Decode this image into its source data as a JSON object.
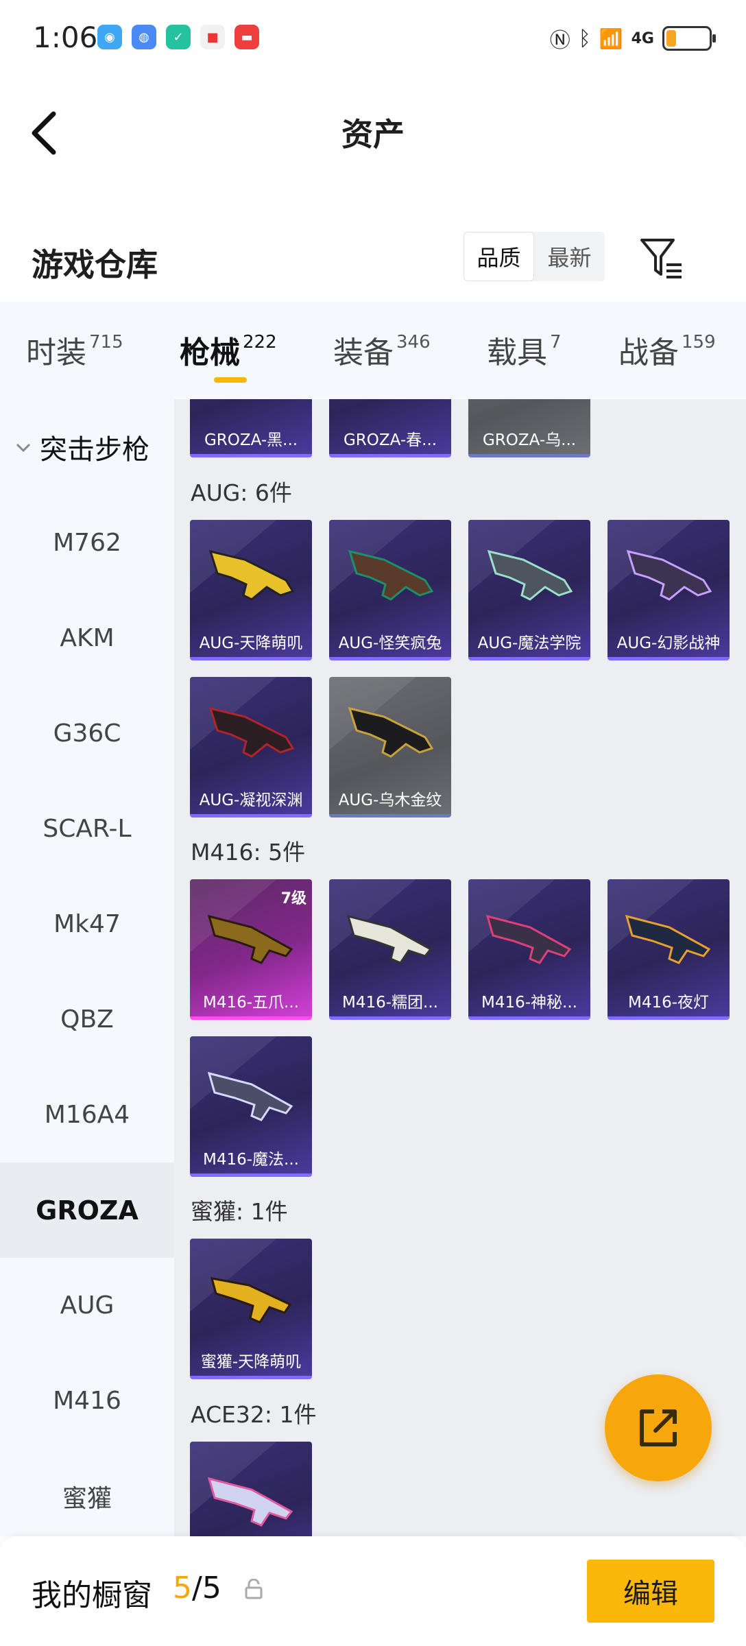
{
  "status_bar": {
    "time": "1:06",
    "signal_text": "4G",
    "wifi_badge": "6",
    "battery_color": "#f5a623"
  },
  "header": {
    "title": "资产",
    "back_icon": "chevron-left-icon"
  },
  "section": {
    "title": "游戏仓库",
    "sort_options": [
      "品质",
      "最新"
    ],
    "sort_selected": "品质",
    "filter_icon": "filter-icon"
  },
  "tabs": [
    {
      "label": "时装",
      "count": "715"
    },
    {
      "label": "枪械",
      "count": "222"
    },
    {
      "label": "装备",
      "count": "346"
    },
    {
      "label": "载具",
      "count": "7"
    },
    {
      "label": "战备",
      "count": "159"
    }
  ],
  "active_tab": "枪械",
  "sidebar": {
    "category": "突击步枪",
    "items": [
      "M762",
      "AKM",
      "G36C",
      "SCAR-L",
      "Mk47",
      "QBZ",
      "M16A4",
      "GROZA",
      "AUG",
      "M416",
      "蜜獾"
    ],
    "selected": "GROZA"
  },
  "groups": {
    "groza_partial": [
      "GROZA-黑...",
      "GROZA-春...",
      "GROZA-乌..."
    ],
    "aug": {
      "header": "AUG: 6件",
      "items": [
        "AUG-天降萌叽",
        "AUG-怪笑疯兔",
        "AUG-魔法学院",
        "AUG-幻影战神",
        "AUG-凝视深渊",
        "AUG-乌木金纹"
      ]
    },
    "m416": {
      "header": "M416: 5件",
      "items": [
        "M416-五爪...",
        "M416-糯团...",
        "M416-神秘...",
        "M416-夜灯",
        "M416-魔法..."
      ],
      "level_badge": "7级"
    },
    "honey_badger": {
      "header": "蜜獾: 1件",
      "items": [
        "蜜獾-天降萌叽"
      ]
    },
    "ace32": {
      "header": "ACE32: 1件"
    }
  },
  "fab": {
    "icon": "share-external-icon",
    "color": "#f7a70b"
  },
  "bottom_bar": {
    "label": "我的橱窗",
    "count_used": "5",
    "count_sep": "/",
    "count_total": "5",
    "lock_icon": "lock-icon",
    "edit_label": "编辑",
    "accent": "#fbb80a"
  }
}
